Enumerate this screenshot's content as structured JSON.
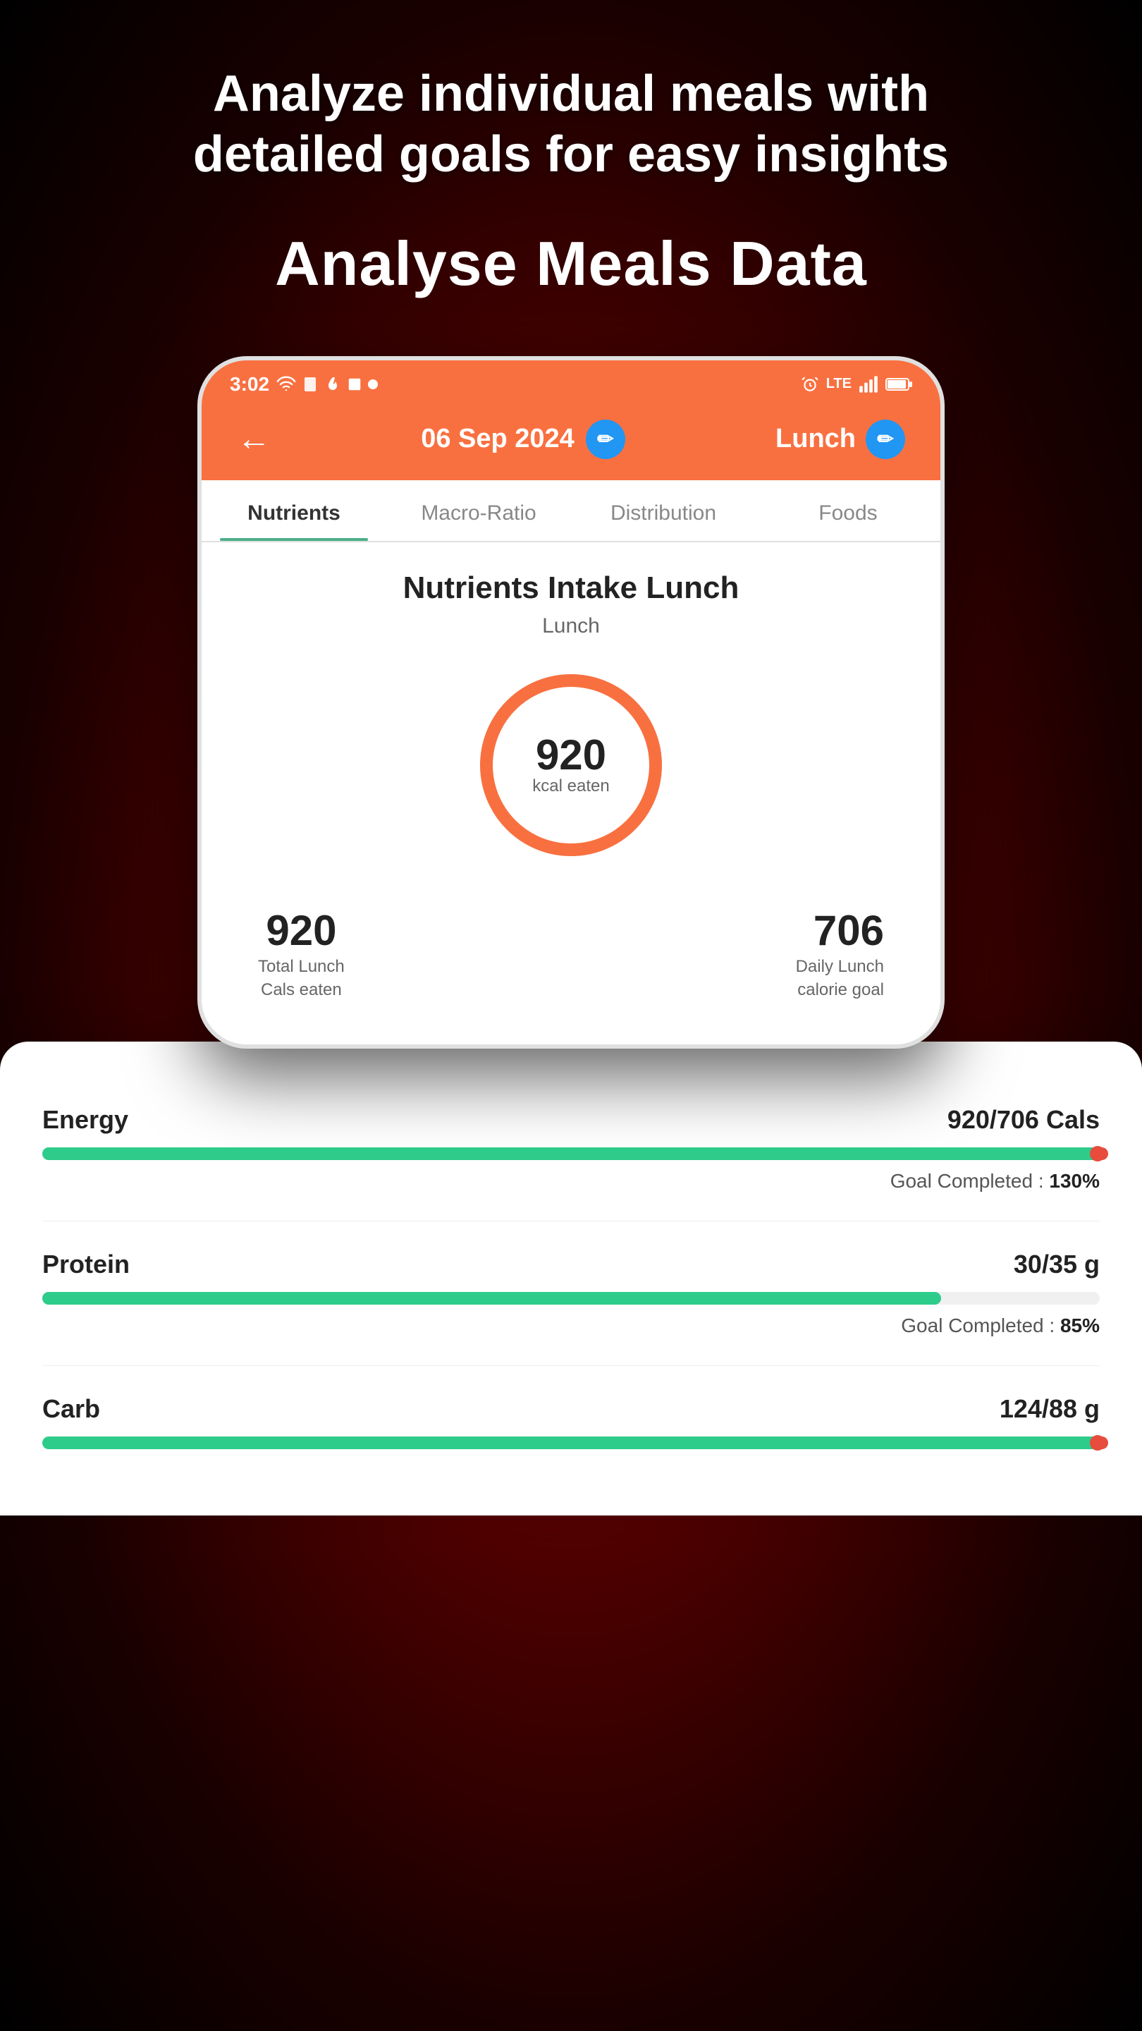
{
  "page": {
    "hero_text": "Analyze individual meals with detailed goals for easy insights",
    "subtitle": "Analyse Meals Data"
  },
  "status_bar": {
    "time": "3:02",
    "left_icons": [
      "wifi-icon",
      "sim-icon",
      "flame-icon",
      "square-icon",
      "dot-icon"
    ],
    "right_icons": [
      "alarm-icon",
      "lte-icon",
      "wifi-icon",
      "signal-icon",
      "battery-icon"
    ]
  },
  "nav": {
    "back_arrow": "←",
    "date": "06 Sep 2024",
    "meal": "Lunch",
    "edit_icon": "✏"
  },
  "tabs": [
    {
      "label": "Nutrients",
      "active": true
    },
    {
      "label": "Macro-Ratio",
      "active": false
    },
    {
      "label": "Distribution",
      "active": false
    },
    {
      "label": "Foods",
      "active": false
    }
  ],
  "intake": {
    "title": "Nutrients Intake Lunch",
    "meal_label": "Lunch",
    "donut_value": "920",
    "donut_unit": "kcal eaten",
    "stat_total_value": "920",
    "stat_total_label_line1": "Total Lunch",
    "stat_total_label_line2": "Cals eaten",
    "stat_goal_value": "706",
    "stat_goal_label_line1": "Daily Lunch",
    "stat_goal_label_line2": "calorie goal"
  },
  "nutrients": [
    {
      "name": "Energy",
      "amount": "920/706 Cals",
      "progress_pct": 100,
      "over_goal": true,
      "goal_text": "Goal Completed : ",
      "goal_pct": "130%",
      "color": "#2ECC8A"
    },
    {
      "name": "Protein",
      "amount": "30/35 g",
      "progress_pct": 85,
      "over_goal": false,
      "goal_text": "Goal Completed : ",
      "goal_pct": "85%",
      "color": "#2ECC8A"
    },
    {
      "name": "Carb",
      "amount": "124/88 g",
      "progress_pct": 100,
      "over_goal": true,
      "goal_text": "",
      "goal_pct": "",
      "color": "#2ECC8A"
    }
  ],
  "colors": {
    "orange": "#F97040",
    "teal": "#2ECC8A",
    "red": "#e74c3c",
    "blue": "#2196F3"
  }
}
